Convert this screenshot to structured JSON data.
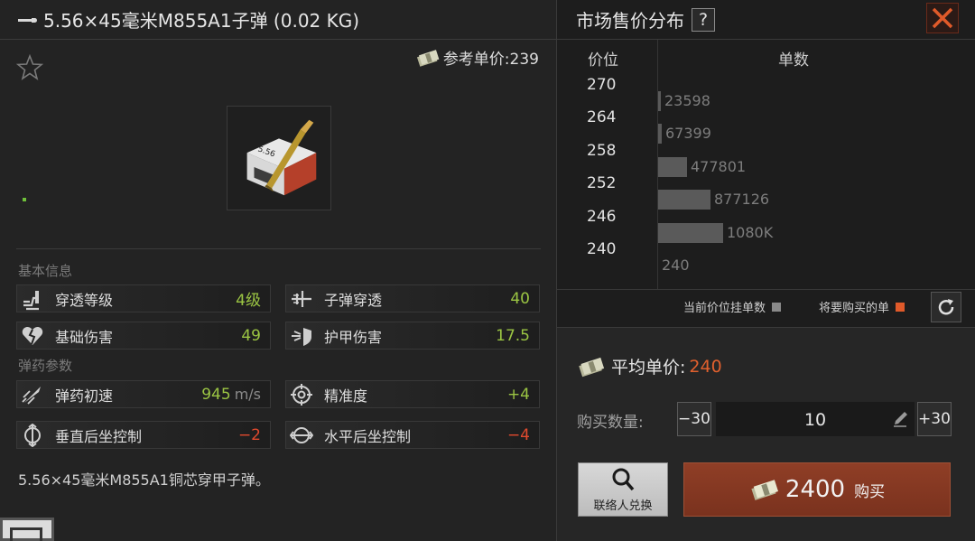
{
  "item": {
    "title": "5.56×45毫米M855A1子弹 (0.02 KG)",
    "ref_price": "参考单价:239",
    "description": "5.56×45毫米M855A1铜芯穿甲子弹。"
  },
  "sections": {
    "basic": "基本信息",
    "ammo": "弹药参数"
  },
  "stats": {
    "penetration_level": {
      "label": "穿透等级",
      "value": "4级"
    },
    "bullet_penetration": {
      "label": "子弹穿透",
      "value": "40"
    },
    "base_damage": {
      "label": "基础伤害",
      "value": "49"
    },
    "armor_damage": {
      "label": "护甲伤害",
      "value": "17.5"
    },
    "muzzle_velocity": {
      "label": "弹药初速",
      "value": "945",
      "unit": "m/s"
    },
    "accuracy": {
      "label": "精准度",
      "value": "+4"
    },
    "vertical_recoil": {
      "label": "垂直后坐控制",
      "value": "−2"
    },
    "horizontal_recoil": {
      "label": "水平后坐控制",
      "value": "−4"
    }
  },
  "market": {
    "title": "市场售价分布",
    "help": "?",
    "col_price": "价位",
    "col_count": "单数",
    "legend_current": "当前价位挂单数",
    "legend_buy": "将要购买的单",
    "colors": {
      "bar": "#5a5a5a",
      "legend_current": "#8a8a8a",
      "legend_buy": "#e05a2a",
      "accent": "#e0602e"
    }
  },
  "chart_data": {
    "type": "bar",
    "orientation": "horizontal",
    "categories": [
      "270",
      "264",
      "258",
      "252",
      "246",
      "240"
    ],
    "labels": [
      "23598",
      "67399",
      "477801",
      "877126",
      "1080K",
      "240"
    ],
    "values": [
      23598,
      67399,
      477801,
      877126,
      1080000,
      0
    ],
    "xlabel": "单数",
    "ylabel": "价位"
  },
  "purchase": {
    "avg_label": "平均单价:",
    "avg_value": "240",
    "qty_label": "购买数量:",
    "minus": "−30",
    "plus": "+30",
    "quantity": "10",
    "exchange_label": "联络人兑换",
    "total": "2400",
    "buy_label": "购买"
  }
}
